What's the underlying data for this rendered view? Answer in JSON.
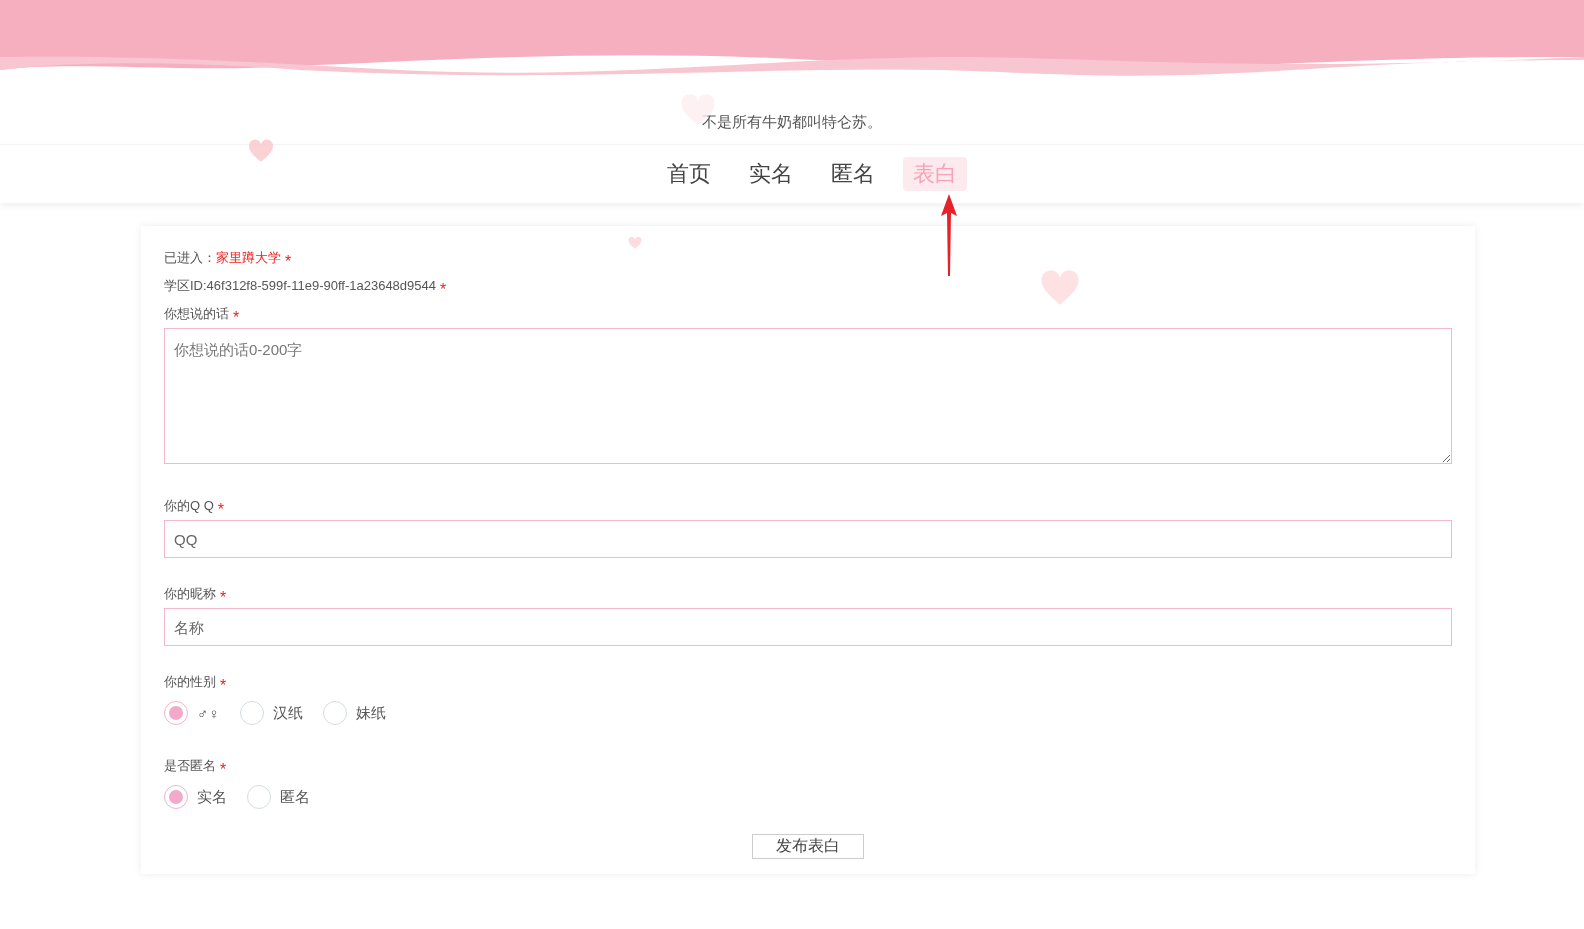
{
  "header": {
    "motto": "不是所有牛奶都叫特仑苏。"
  },
  "nav": [
    {
      "label": "首页",
      "selected": false
    },
    {
      "label": "实名",
      "selected": false
    },
    {
      "label": "匿名",
      "selected": false
    },
    {
      "label": "表白",
      "selected": true
    }
  ],
  "form": {
    "entered": {
      "label": "已进入：",
      "school": "家里蹲大学",
      "mark": "*"
    },
    "school_id": {
      "text": "学区ID:46f312f8-599f-11e9-90ff-1a23648d9544",
      "mark": "*"
    },
    "fields": [
      {
        "kind": "textarea",
        "label": "你想说的话",
        "mark": "*",
        "placeholder": "你想说的话0-200字"
      },
      {
        "kind": "input",
        "label": "你的Q Q",
        "mark": "*",
        "placeholder": "QQ"
      },
      {
        "kind": "input",
        "label": "你的昵称",
        "mark": "*",
        "placeholder": "名称"
      },
      {
        "kind": "radio",
        "label": "你的性别",
        "mark": "*",
        "options": [
          {
            "label": "♂♀",
            "selected": true
          },
          {
            "label": "汉纸",
            "selected": false
          },
          {
            "label": "妹纸",
            "selected": false
          }
        ]
      },
      {
        "kind": "radio",
        "label": "是否匿名",
        "mark": "*",
        "options": [
          {
            "label": "实名",
            "selected": true
          },
          {
            "label": "匿名",
            "selected": false
          }
        ]
      }
    ],
    "submit": "发布表白"
  }
}
